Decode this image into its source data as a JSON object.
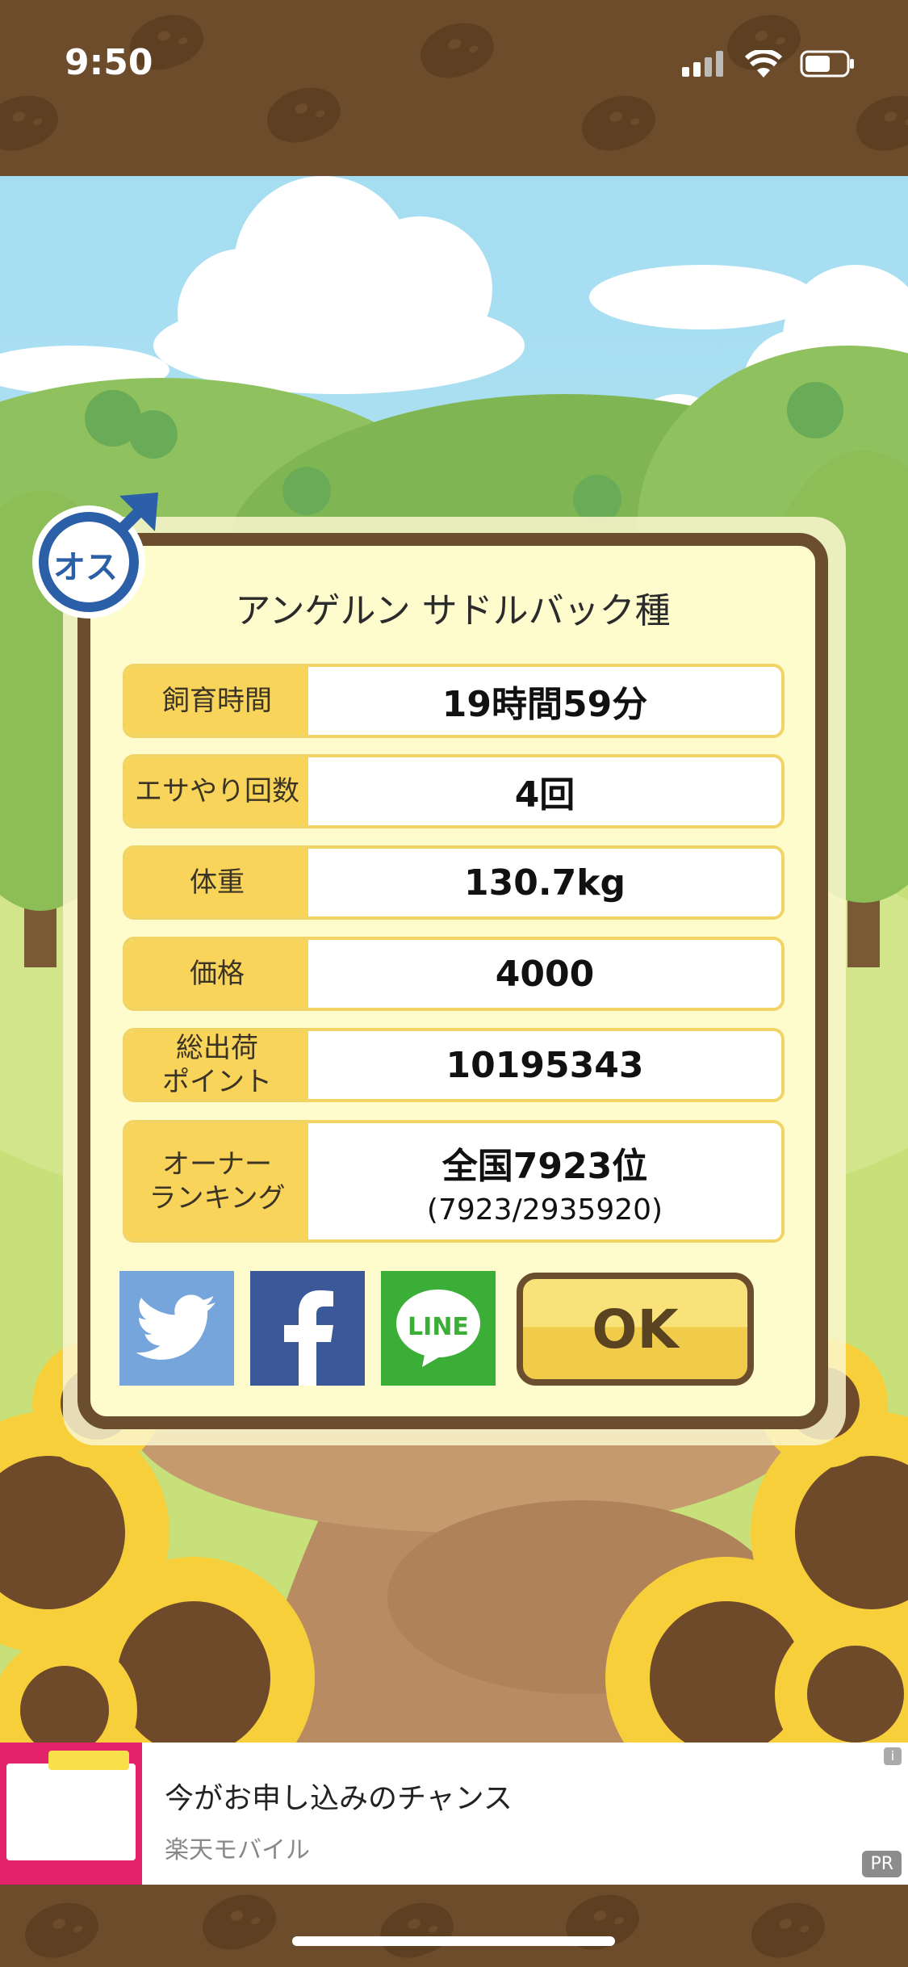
{
  "status_bar": {
    "time": "9:50"
  },
  "dialog": {
    "gender_badge": "オス",
    "title": "アンゲルン サドルバック種",
    "rows": [
      {
        "label": "飼育時間",
        "value": "19時間59分",
        "sub": ""
      },
      {
        "label": "エサやり回数",
        "value": "4回",
        "sub": ""
      },
      {
        "label": "体重",
        "value": "130.7kg",
        "sub": ""
      },
      {
        "label": "価格",
        "value": "4000",
        "sub": ""
      },
      {
        "label": "総出荷\nポイント",
        "value": "10195343",
        "sub": ""
      },
      {
        "label": "オーナー\nランキング",
        "value": "全国7923位",
        "sub": "(7923/2935920)"
      }
    ],
    "share": {
      "twitter_icon": "twitter-icon",
      "facebook_icon": "facebook-icon",
      "line_label": "LINE"
    },
    "ok_label": "OK"
  },
  "ad": {
    "title": "今がお申し込みのチャンス",
    "advertiser": "楽天モバイル",
    "pr_label": "PR",
    "info_label": "i"
  },
  "colors": {
    "brown": "#6b4e2e",
    "yellow": "#f8d55a",
    "twitter": "#76a5db",
    "facebook": "#3b5998",
    "line": "#3aae36"
  }
}
